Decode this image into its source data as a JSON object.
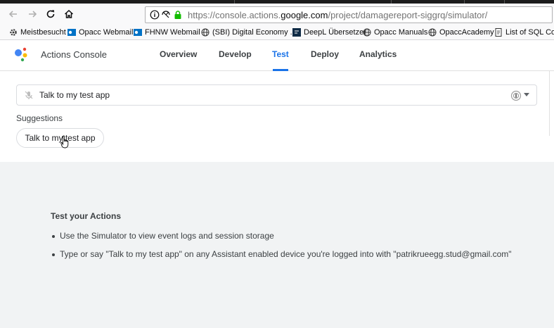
{
  "browser": {
    "url_prefix": "https://console.actions.",
    "url_domain": "google.com",
    "url_suffix": "/project/damagereport-siggrq/simulator/",
    "bookmarks": [
      {
        "label": "Meistbesucht",
        "icon": "gear-icon"
      },
      {
        "label": "Opacc Webmail",
        "icon": "outlook-icon"
      },
      {
        "label": "FHNW Webmail",
        "icon": "outlook-icon"
      },
      {
        "label": "(SBI) Digital Economy ...",
        "icon": "globe-icon"
      },
      {
        "label": "DeepL Übersetzer",
        "icon": "deepl-icon"
      },
      {
        "label": "Opacc Manuals",
        "icon": "globe-icon"
      },
      {
        "label": "OpaccAcademy",
        "icon": "globe-icon"
      },
      {
        "label": "List of SQL Com",
        "icon": "page-icon"
      }
    ]
  },
  "app": {
    "title": "Actions Console",
    "tabs": [
      "Overview",
      "Develop",
      "Test",
      "Deploy",
      "Analytics"
    ],
    "active_tab": "Test",
    "accent_color": "#1a73e8"
  },
  "simulator": {
    "input_text": "Talk to my test app",
    "suggestions_label": "Suggestions",
    "suggestion_chip": "Talk to my test app"
  },
  "panel": {
    "title": "Test your Actions",
    "bullets": [
      "Use the Simulator to view event logs and session storage",
      "Type or say \"Talk to my test app\" on any Assistant enabled device you're logged into with \"patrikrueegg.stud@gmail.com\""
    ]
  }
}
